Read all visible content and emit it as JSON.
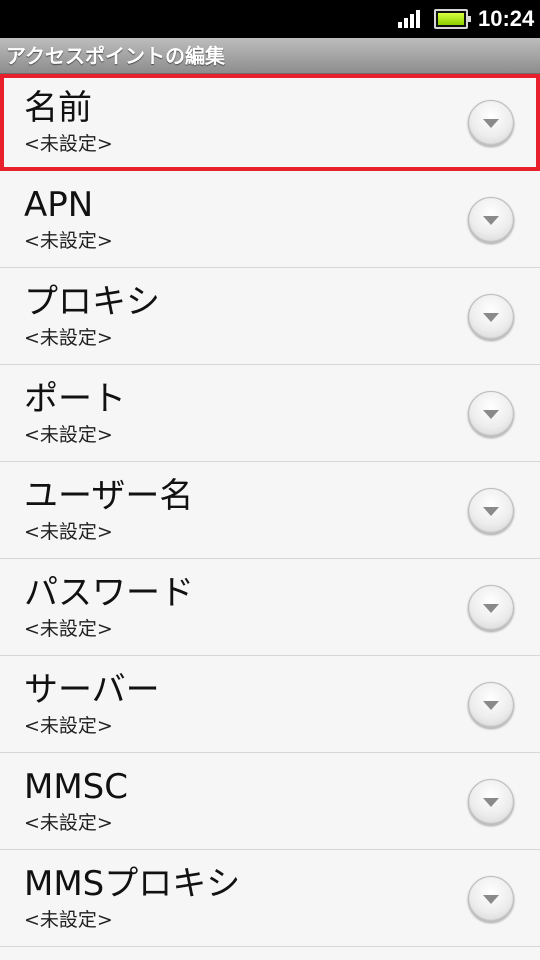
{
  "status_bar": {
    "signal_icon": "signal-bars-icon",
    "battery_icon": "battery-icon",
    "battery_color": "#a6e600",
    "time": "10:24"
  },
  "header": {
    "title": "アクセスポイントの編集"
  },
  "list": {
    "items": [
      {
        "label": "名前",
        "value": "<未設定>",
        "selected": true
      },
      {
        "label": "APN",
        "value": "<未設定>"
      },
      {
        "label": "プロキシ",
        "value": "<未設定>"
      },
      {
        "label": "ポート",
        "value": "<未設定>"
      },
      {
        "label": "ユーザー名",
        "value": "<未設定>"
      },
      {
        "label": "パスワード",
        "value": "<未設定>"
      },
      {
        "label": "サーバー",
        "value": "<未設定>"
      },
      {
        "label": "MMSC",
        "value": "<未設定>"
      },
      {
        "label": "MMSプロキシ",
        "value": "<未設定>"
      }
    ],
    "dropdown_icon": "chevron-down-icon",
    "highlight_color": "#e8202c"
  }
}
